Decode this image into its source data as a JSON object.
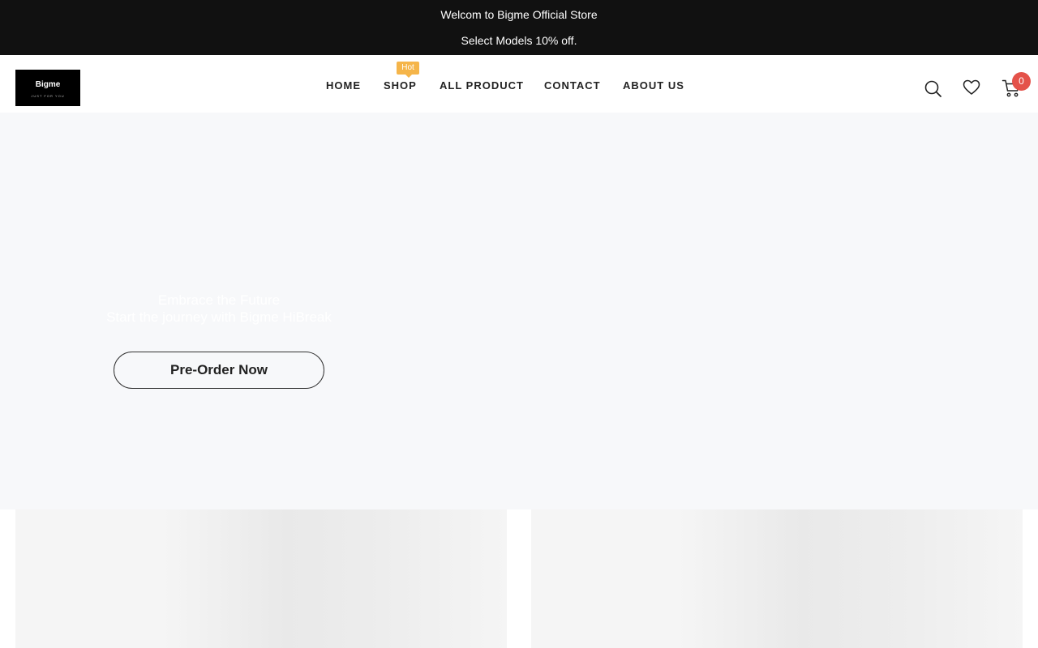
{
  "announcement": {
    "line1": "Welcom to Bigme Official Store",
    "line2": "Select Models 10% off."
  },
  "logo": {
    "name": "Bigme",
    "tagline": "JUST FOR YOU"
  },
  "nav": {
    "items": [
      {
        "label": "HOME"
      },
      {
        "label": "SHOP",
        "badge": "Hot"
      },
      {
        "label": "ALL PRODUCT"
      },
      {
        "label": "CONTACT"
      },
      {
        "label": "ABOUT US"
      }
    ]
  },
  "header_icons": {
    "search": "search-icon",
    "wishlist": "heart-icon",
    "cart": "cart-icon",
    "cart_count": "0"
  },
  "hero": {
    "headline": "Embrace the Future",
    "subheadline": "Start the journey with Bigme HiBreak",
    "cta_label": "Pre-Order Now"
  },
  "colors": {
    "announcement_bg": "#111111",
    "badge": "#f5b54a",
    "cart_count": "#e4524a",
    "hero_bg": "#f7f8fa"
  }
}
